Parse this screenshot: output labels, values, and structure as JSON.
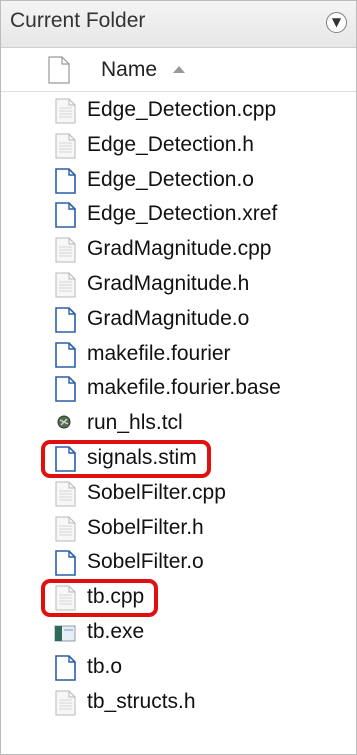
{
  "panel": {
    "title": "Current Folder",
    "menu_glyph": "▼"
  },
  "header": {
    "column_label": "Name"
  },
  "files": [
    {
      "name": "Edge_Detection.cpp",
      "icon": "source-file-icon"
    },
    {
      "name": "Edge_Detection.h",
      "icon": "source-file-icon"
    },
    {
      "name": "Edge_Detection.o",
      "icon": "generic-file-icon"
    },
    {
      "name": "Edge_Detection.xref",
      "icon": "generic-file-icon"
    },
    {
      "name": "GradMagnitude.cpp",
      "icon": "source-file-icon"
    },
    {
      "name": "GradMagnitude.h",
      "icon": "source-file-icon"
    },
    {
      "name": "GradMagnitude.o",
      "icon": "generic-file-icon"
    },
    {
      "name": "makefile.fourier",
      "icon": "generic-file-icon"
    },
    {
      "name": "makefile.fourier.base",
      "icon": "generic-file-icon"
    },
    {
      "name": "run_hls.tcl",
      "icon": "tcl-script-icon"
    },
    {
      "name": "signals.stim",
      "icon": "generic-file-icon",
      "highlighted": true
    },
    {
      "name": "SobelFilter.cpp",
      "icon": "source-file-icon"
    },
    {
      "name": "SobelFilter.h",
      "icon": "source-file-icon"
    },
    {
      "name": "SobelFilter.o",
      "icon": "generic-file-icon"
    },
    {
      "name": "tb.cpp",
      "icon": "source-file-icon",
      "highlighted": true
    },
    {
      "name": "tb.exe",
      "icon": "executable-icon"
    },
    {
      "name": "tb.o",
      "icon": "generic-file-icon"
    },
    {
      "name": "tb_structs.h",
      "icon": "source-file-icon"
    }
  ],
  "colors": {
    "highlight": "#e01010",
    "accent_file": "#2b5fa8"
  }
}
